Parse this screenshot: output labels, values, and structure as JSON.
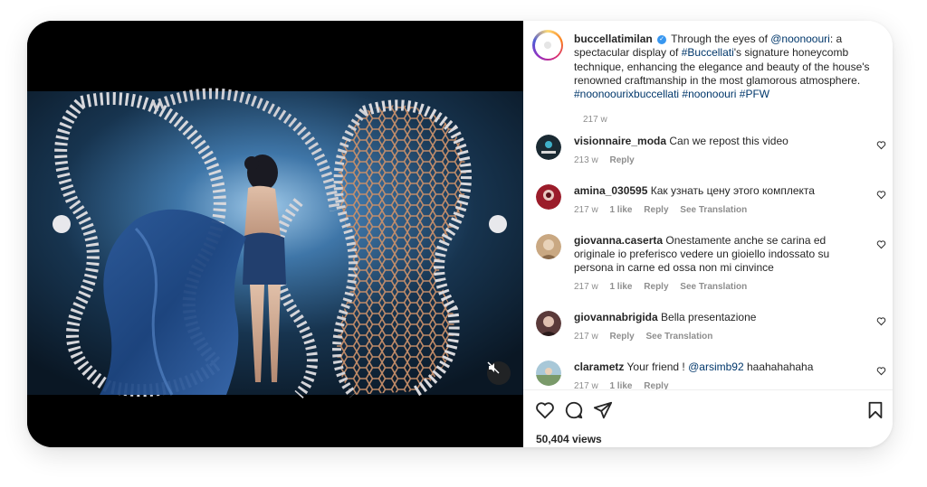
{
  "post": {
    "username": "buccellatimilan",
    "caption_lead": "Through the eyes of ",
    "mention1": "@noonoouri",
    "caption_2": ": a spectacular display of ",
    "hashtag1": "#Buccellati",
    "caption_3": "'s signature honeycomb technique, enhancing the elegance and beauty of the house's renowned craftmanship in the most glamorous atmosphere. ",
    "hashtags": "#noonoourixbuccellati #noonoouri #PFW",
    "time": "217 w",
    "views": "50,404 views"
  },
  "comments": [
    {
      "username": "visionnaire_moda",
      "text": "Can we repost this video",
      "time": "213 w",
      "likes": "",
      "reply": "Reply",
      "translate": "",
      "avatar_color": "#1a2a33"
    },
    {
      "username": "amina_030595",
      "text": "Как узнать цену этого комплекта",
      "time": "217 w",
      "likes": "1 like",
      "reply": "Reply",
      "translate": "See Translation",
      "avatar_color": "#9b1c2a"
    },
    {
      "username": "giovanna.caserta",
      "text": "Onestamente anche se carina ed originale io preferisco vedere un gioiello indossato su persona in carne ed ossa non mi cinvince",
      "time": "217 w",
      "likes": "1 like",
      "reply": "Reply",
      "translate": "See Translation",
      "avatar_color": "#c9a882"
    },
    {
      "username": "giovannabrigida",
      "text": "Bella presentazione",
      "time": "217 w",
      "likes": "",
      "reply": "Reply",
      "translate": "See Translation",
      "avatar_color": "#5a3a3a"
    },
    {
      "username": "clarametz",
      "text_lead": "Your friend ! ",
      "mention": "@arsimb92",
      "text_tail": " haahahahaha",
      "time": "217 w",
      "likes": "1 like",
      "reply": "Reply",
      "translate": "",
      "avatar_color": "#7a9a6a"
    }
  ],
  "icons": {
    "like": "heart-icon",
    "comment": "comment-icon",
    "share": "share-icon",
    "save": "bookmark-icon",
    "mute": "muted-speaker-icon",
    "verified": "verified-badge-icon"
  },
  "colors": {
    "link": "#00376b",
    "meta": "#8e8e8e",
    "text": "#262626"
  }
}
